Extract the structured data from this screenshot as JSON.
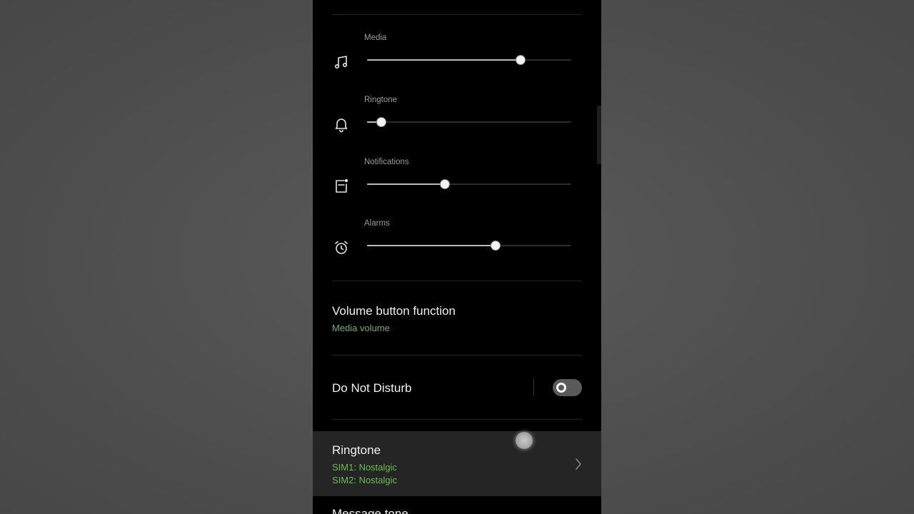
{
  "volume": {
    "items": [
      {
        "label": "Media",
        "icon": "music-note-icon",
        "level": 0.75
      },
      {
        "label": "Ringtone",
        "icon": "bell-icon",
        "level": 0.07
      },
      {
        "label": "Notifications",
        "icon": "notification-icon",
        "level": 0.38
      },
      {
        "label": "Alarms",
        "icon": "alarm-clock-icon",
        "level": 0.63
      }
    ]
  },
  "volume_button": {
    "title": "Volume button function",
    "value": "Media volume"
  },
  "do_not_disturb": {
    "title": "Do Not Disturb",
    "enabled": false
  },
  "ringtone": {
    "title": "Ringtone",
    "sim1": "SIM1: Nostalgic",
    "sim2": "SIM2: Nostalgic"
  },
  "message_tone": {
    "title": "Message tone"
  },
  "colors": {
    "accent_green": "#6fb558",
    "background": "#000000",
    "highlight_row": "#252525"
  }
}
